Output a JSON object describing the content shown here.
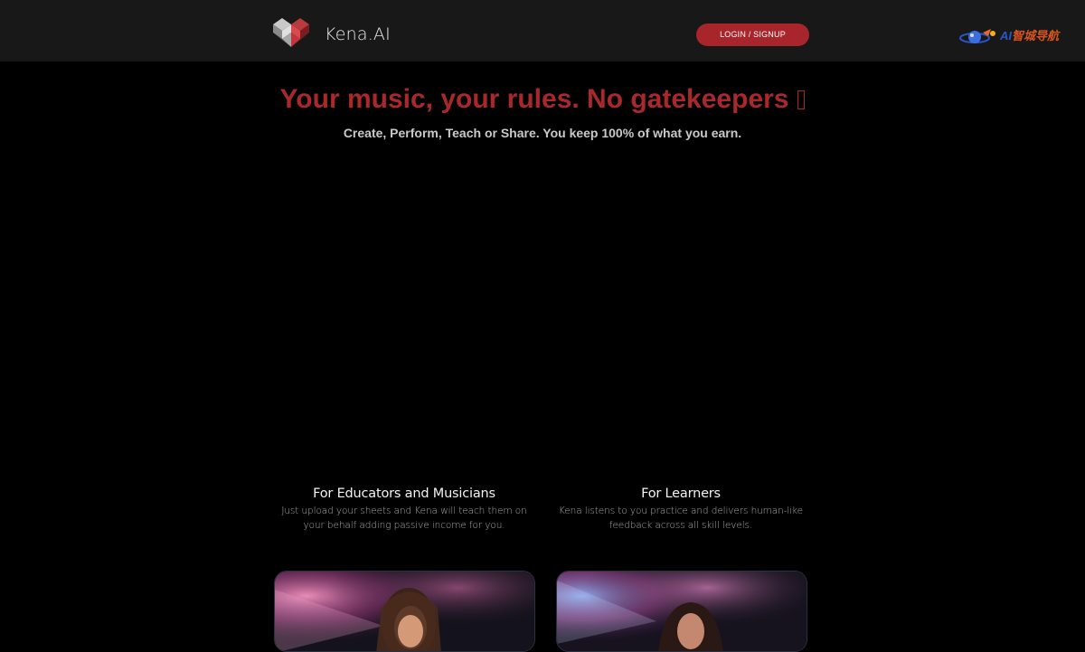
{
  "header": {
    "brand_name": "Kena.AI",
    "login_label": "LOGIN / SIGNUP",
    "partner_badge": {
      "prefix": "AI",
      "suffix": "智城导航",
      "globe_text": "AI"
    }
  },
  "hero": {
    "title": "Your music, your rules. No gatekeepers",
    "title_icon": "missing-glyph-icon",
    "subtitle": "Create, Perform, Teach or Share. You keep 100% of what you earn."
  },
  "features": [
    {
      "title": "For Educators and Musicians",
      "description": "Just upload your sheets and Kena will teach them on your behalf adding passive income for you."
    },
    {
      "title": "For Learners",
      "description": "Kena listens to you practice and delivers human-like feedback across all skill levels."
    }
  ],
  "colors": {
    "accent_red": "#a8282c",
    "button_red": "#a8252b",
    "header_bg": "#181818",
    "page_bg": "#000000"
  }
}
